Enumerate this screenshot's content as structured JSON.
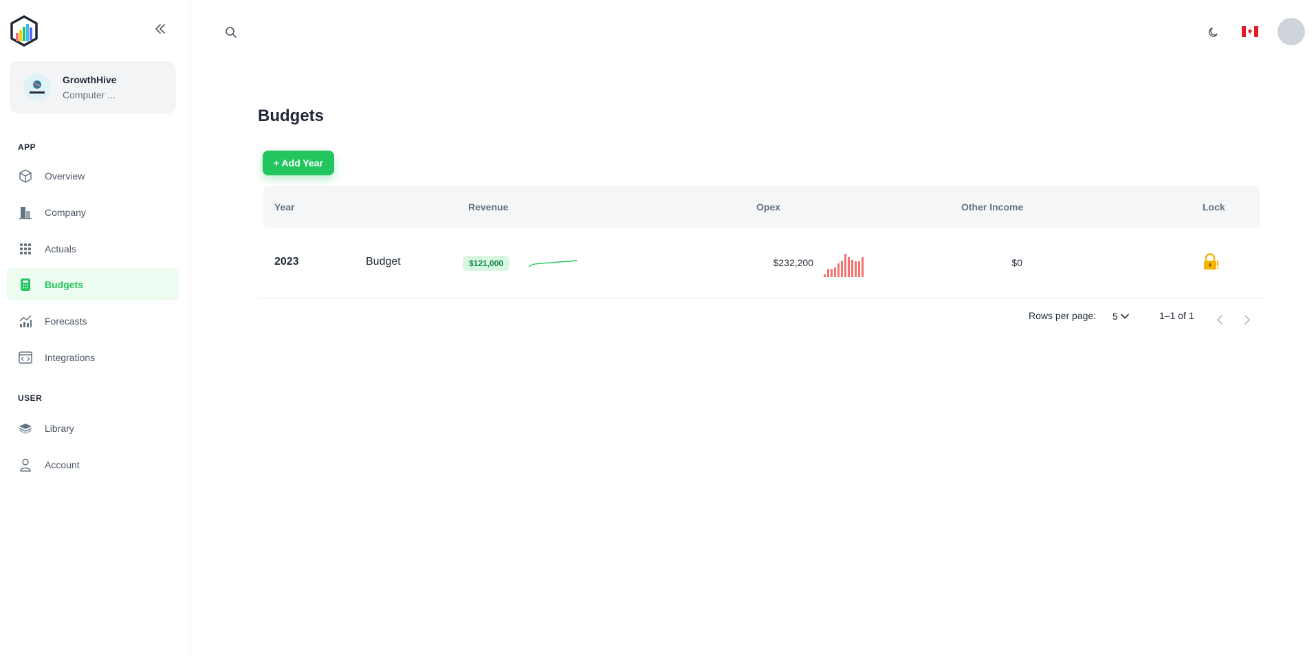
{
  "sidebar": {
    "org": {
      "name": "GrowthHive",
      "subtitle": "Computer ..."
    },
    "sections": {
      "app": "APP",
      "user": "USER"
    },
    "app_items": [
      {
        "label": "Overview",
        "icon": "cube-icon"
      },
      {
        "label": "Company",
        "icon": "building-icon"
      },
      {
        "label": "Actuals",
        "icon": "grid-icon"
      },
      {
        "label": "Budgets",
        "icon": "calculator-icon",
        "active": true
      },
      {
        "label": "Forecasts",
        "icon": "chart-icon"
      },
      {
        "label": "Integrations",
        "icon": "code-window-icon"
      }
    ],
    "user_items": [
      {
        "label": "Library",
        "icon": "books-icon"
      },
      {
        "label": "Account",
        "icon": "user-icon"
      }
    ]
  },
  "colors": {
    "accent": "#22c55e",
    "accent_light": "#eefbf1",
    "revenue_badge_bg": "#d8f7e2",
    "revenue_badge_text": "#11894a",
    "opex_bars": "#f87171",
    "lock": "#f5b400"
  },
  "main": {
    "title": "Budgets",
    "add_button": "+ Add Year",
    "table": {
      "headers": [
        "Year",
        "Revenue",
        "Opex",
        "Other Income",
        "Lock"
      ],
      "rows": [
        {
          "year": "2023",
          "type": "Budget",
          "revenue": "$121,000",
          "opex": "$232,200",
          "other_income": "$0",
          "locked": true
        }
      ]
    },
    "pagination": {
      "rows_per_page_label": "Rows per page:",
      "rows_per_page": "5",
      "range": "1–1 of 1"
    }
  }
}
